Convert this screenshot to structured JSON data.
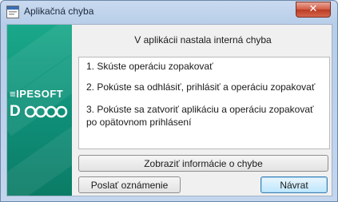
{
  "window": {
    "title": "Aplikačná chyba"
  },
  "banner": {
    "logo_text": "IPESOFT",
    "logo_product": "D2000"
  },
  "dialog": {
    "header": "V aplikácii nastala interná chyba",
    "items": [
      "1. Skúste operáciu zopakovať",
      "2. Pokúste sa odhlásiť, prihlásiť a operáciu zopakovať",
      "3. Pokúste sa zatvoriť aplikáciu a operáciu zopakovať po opätovnom prihlásení"
    ]
  },
  "buttons": {
    "details": "Zobraziť informácie o chybe",
    "send_report": "Poslať oznámenie",
    "return": "Návrat"
  },
  "colors": {
    "banner": "#0f8e77",
    "titlebar": "#c9daf0",
    "close": "#d15a42"
  }
}
